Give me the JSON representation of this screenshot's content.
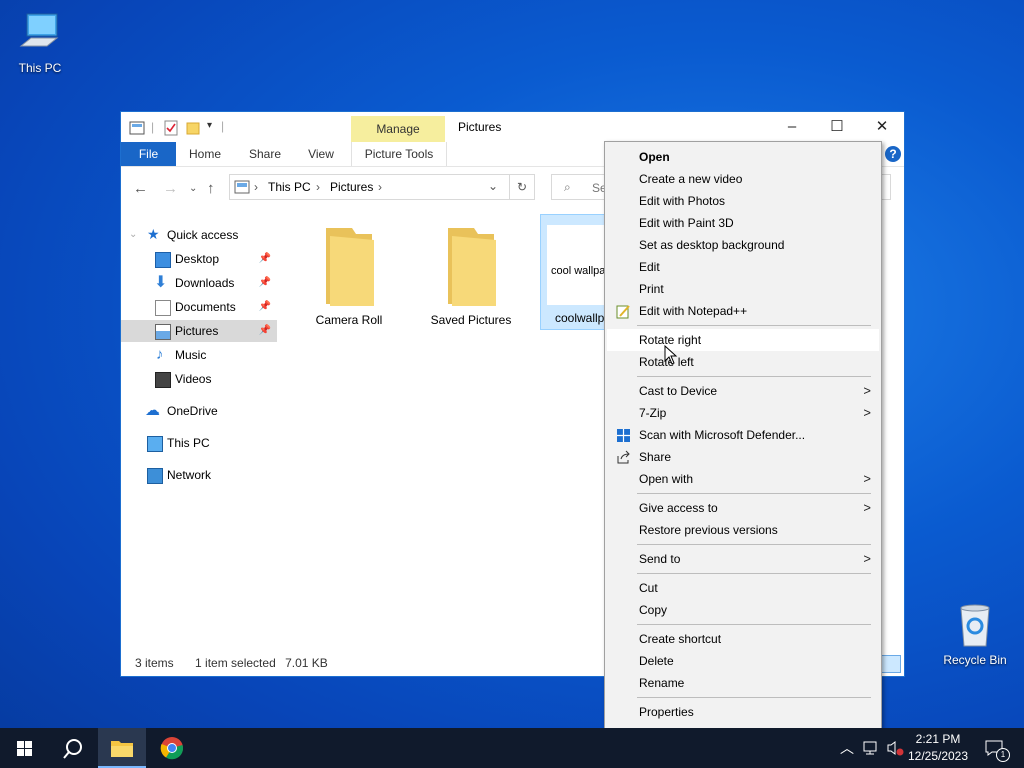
{
  "desktop": {
    "this_pc_label": "This PC",
    "recycle_bin_label": "Recycle Bin"
  },
  "window": {
    "title": "Pictures",
    "manage_tab": "Manage",
    "ribbon_tabs": [
      "File",
      "Home",
      "Share",
      "View",
      "Picture Tools"
    ],
    "address": {
      "segments": [
        "This PC",
        "Pictures"
      ]
    },
    "search_placeholder": "Se",
    "nav": {
      "quick_access": "Quick access",
      "desktop": "Desktop",
      "downloads": "Downloads",
      "documents": "Documents",
      "pictures": "Pictures",
      "music": "Music",
      "videos": "Videos",
      "onedrive": "OneDrive",
      "this_pc": "This PC",
      "network": "Network"
    },
    "files": {
      "camera_roll": "Camera Roll",
      "saved_pictures": "Saved Pictures",
      "coolwallpaper": "coolwallp",
      "thumb_text": "cool wallpa"
    },
    "status": {
      "items": "3 items",
      "selected": "1 item selected",
      "size": "7.01 KB"
    }
  },
  "context_menu": {
    "open": "Open",
    "create_video": "Create a new video",
    "edit_photos": "Edit with Photos",
    "edit_paint3d": "Edit with Paint 3D",
    "set_background": "Set as desktop background",
    "edit": "Edit",
    "print": "Print",
    "edit_notepadpp": "Edit with Notepad++",
    "rotate_right": "Rotate right",
    "rotate_left": "Rotate left",
    "cast": "Cast to Device",
    "zip": "7-Zip",
    "defender": "Scan with Microsoft Defender...",
    "share": "Share",
    "open_with": "Open with",
    "give_access": "Give access to",
    "restore": "Restore previous versions",
    "send_to": "Send to",
    "cut": "Cut",
    "copy": "Copy",
    "create_shortcut": "Create shortcut",
    "delete": "Delete",
    "rename": "Rename",
    "properties": "Properties"
  },
  "taskbar": {
    "time": "2:21 PM",
    "date": "12/25/2023",
    "notification_count": "1"
  },
  "colors": {
    "accent": "#1966c7",
    "manage_tab": "#f6ee9e",
    "taskbar": "#101a2c"
  }
}
